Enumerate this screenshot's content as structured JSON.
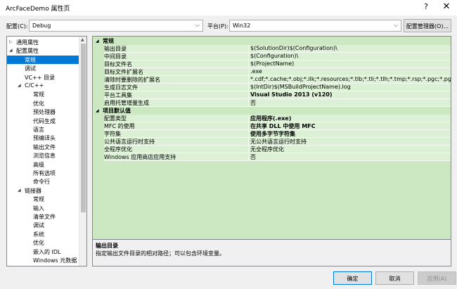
{
  "window": {
    "title": "ArcFaceDemo 属性页",
    "help_glyph": "?",
    "close_glyph": "✕"
  },
  "toolbar": {
    "config_label": "配置(C):",
    "config_value": "Debug",
    "platform_label": "平台(P):",
    "platform_value": "Win32",
    "config_manager_label": "配置管理器(O)..."
  },
  "tree": {
    "items": [
      {
        "label": "通用属性",
        "arrow": "▷"
      },
      {
        "label": "配置属性",
        "arrow": "◢"
      },
      {
        "label": "常规"
      },
      {
        "label": "调试"
      },
      {
        "label": "VC++ 目录"
      },
      {
        "label": "C/C++",
        "arrow": "◢"
      },
      {
        "label": "常规"
      },
      {
        "label": "优化"
      },
      {
        "label": "预处理器"
      },
      {
        "label": "代码生成"
      },
      {
        "label": "语言"
      },
      {
        "label": "预编译头"
      },
      {
        "label": "输出文件"
      },
      {
        "label": "浏览信息"
      },
      {
        "label": "高级"
      },
      {
        "label": "所有选项"
      },
      {
        "label": "命令行"
      },
      {
        "label": "链接器",
        "arrow": "◢"
      },
      {
        "label": "常规"
      },
      {
        "label": "输入"
      },
      {
        "label": "清单文件"
      },
      {
        "label": "调试"
      },
      {
        "label": "系统"
      },
      {
        "label": "优化"
      },
      {
        "label": "嵌入的 IDL"
      },
      {
        "label": "Windows 元数据"
      }
    ],
    "selected_index": 2
  },
  "grid": {
    "sections": [
      {
        "title": "常规",
        "arrow": "◢",
        "rows": [
          {
            "name": "输出目录",
            "value": "$(SolutionDir)$(Configuration)\\"
          },
          {
            "name": "中间目录",
            "value": "$(Configuration)\\"
          },
          {
            "name": "目标文件名",
            "value": "$(ProjectName)"
          },
          {
            "name": "目标文件扩展名",
            "value": ".exe"
          },
          {
            "name": "清除时要删除的扩展名",
            "value": "*.cdf;*.cache;*.obj;*.ilk;*.resources;*.tlb;*.tli;*.tlh;*.tmp;*.rsp;*.pgc;*.pgd;*.meta;*.tlog"
          },
          {
            "name": "生成日志文件",
            "value": "$(IntDir)$(MSBuildProjectName).log"
          },
          {
            "name": "平台工具集",
            "value": "Visual Studio 2013 (v120)",
            "bold": true
          },
          {
            "name": "启用托管增量生成",
            "value": "否"
          }
        ]
      },
      {
        "title": "项目默认值",
        "arrow": "◢",
        "rows": [
          {
            "name": "配置类型",
            "value": "应用程序(.exe)",
            "bold": true
          },
          {
            "name": "MFC 的使用",
            "value": "在共享 DLL 中使用 MFC",
            "bold": true
          },
          {
            "name": "字符集",
            "value": "使用多字节字符集",
            "bold": true
          },
          {
            "name": "公共语言运行时支持",
            "value": "无公共语言运行时支持"
          },
          {
            "name": "全程序优化",
            "value": "无全程序优化"
          },
          {
            "name": "Windows 应用商店应用支持",
            "value": "否"
          }
        ]
      }
    ]
  },
  "description": {
    "title": "输出目录",
    "text": "指定输出文件目录的相对路径；可以包含环境变量。"
  },
  "buttons": {
    "ok": "确定",
    "cancel": "取消",
    "apply": "应用(A)"
  },
  "colors": {
    "selection": "#0078d7",
    "grid_bg": "#dbf0d4",
    "section_bg": "#cbe8c3"
  }
}
